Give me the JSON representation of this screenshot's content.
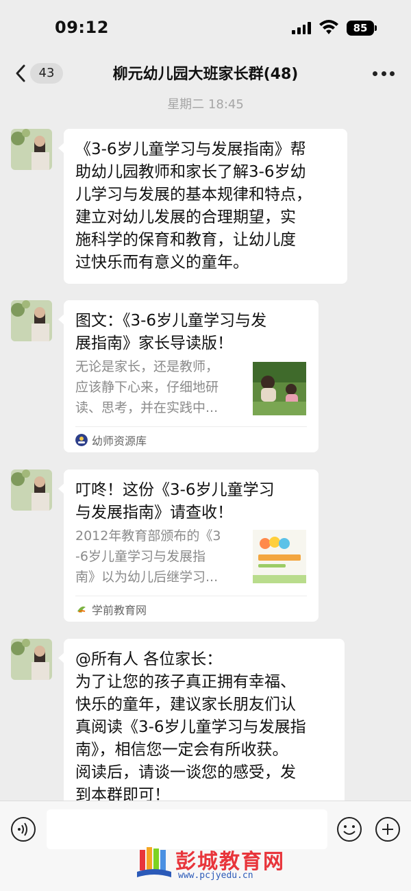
{
  "status_bar": {
    "time": "09:12",
    "battery": "85"
  },
  "header": {
    "back_count": "43",
    "title": "柳元幼儿园大班家长群(48)"
  },
  "chat": {
    "timestamp": "星期二 18:45",
    "messages": [
      {
        "type": "text",
        "text": "《3-6岁儿童学习与发展指南》帮\n助幼儿园教师和家长了解3-6岁幼\n儿学习与发展的基本规律和特点，\n建立对幼儿发展的合理期望，实\n施科学的保育和教育，让幼儿度\n过快乐而有意义的童年。"
      },
      {
        "type": "link_card",
        "title": "图文：《3-6岁儿童学习与发\n展指南》家长导读版！",
        "description": "无论是家长，还是教师，\n应该静下心来，仔细地研\n读、思考，并在实践中...",
        "source": "幼师资源库",
        "thumbnail": "photo-mother-child-tea-field"
      },
      {
        "type": "link_card",
        "title": "叮咚！这份《3-6岁儿童学习\n与发展指南》请查收！",
        "description": "2012年教育部颁布的《3\n-6岁儿童学习与发展指\n南》以为幼儿后继学习...",
        "source": "学前教育网",
        "thumbnail": "cover-3-6-learning-guide"
      },
      {
        "type": "text",
        "text": "@所有人 各位家长：\n为了让您的孩子真正拥有幸福、\n快乐的童年，建议家长朋友们认\n真阅读《3-6岁儿童学习与发展指\n南》，相信您一定会有所收获。\n阅读后，请谈一谈您的感受，发\n到本群即可！"
      }
    ]
  },
  "input_bar": {
    "placeholder": ""
  },
  "watermark": {
    "name": "彭城教育网",
    "url": "www.pcjyedu.cn"
  },
  "colors": {
    "background": "#ededed",
    "bubble": "#ffffff",
    "watermark_red": "#e8353b"
  }
}
